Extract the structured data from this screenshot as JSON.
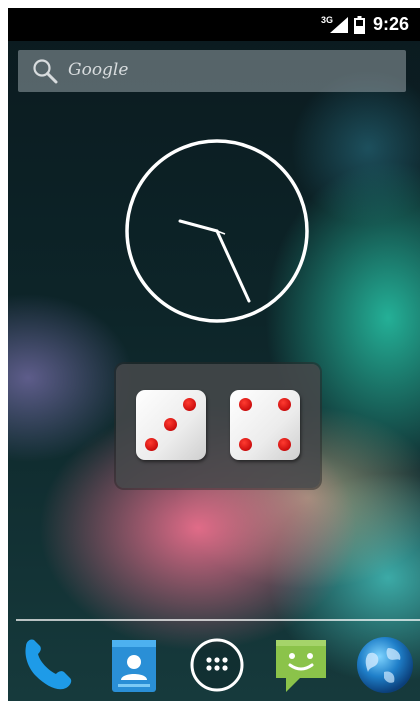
{
  "status_bar": {
    "network_type": "3G",
    "time": "9:26",
    "icons": [
      "signal-icon",
      "battery-icon"
    ]
  },
  "search": {
    "label": "Google",
    "icon": "search-icon"
  },
  "clock_widget": {
    "time_shown": "9:26"
  },
  "dice_widget": {
    "left_die_value": 3,
    "right_die_value": 4
  },
  "dock": {
    "items": [
      "phone-icon",
      "contacts-icon",
      "all-apps-icon",
      "messaging-icon",
      "browser-icon"
    ]
  },
  "colors": {
    "status_bar_bg": "#000000",
    "pip_red": "#cc0d0d",
    "messaging_green": "#8bc34a",
    "phone_blue": "#1e9be8"
  }
}
